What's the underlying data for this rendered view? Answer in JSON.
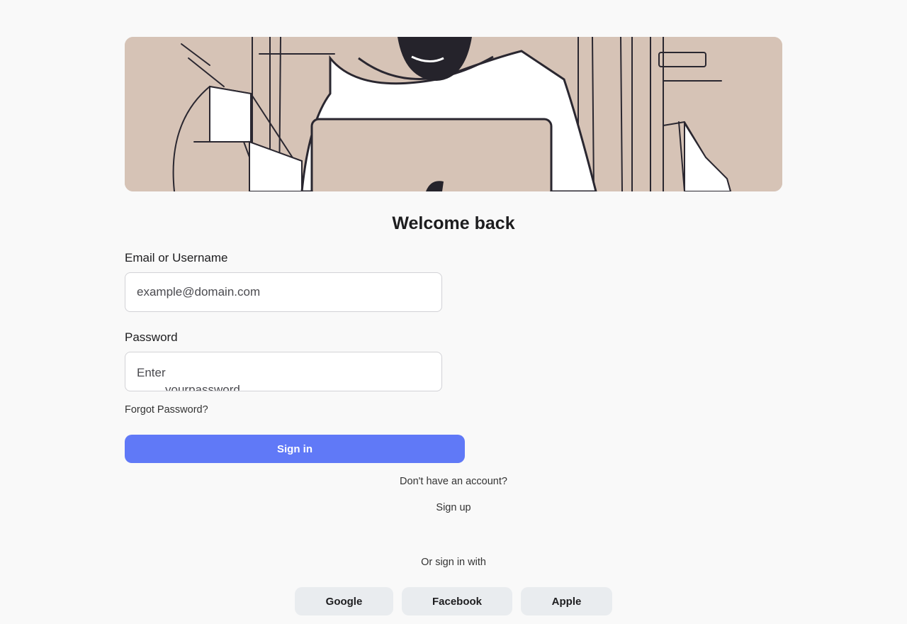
{
  "page": {
    "title": "Welcome back"
  },
  "form": {
    "email_label": "Email or Username",
    "email_placeholder": "example@domain.com",
    "email_value": "",
    "password_label": "Password",
    "password_placeholder_line1": "Enter",
    "password_placeholder_line2": "yourpassword",
    "password_value": "",
    "forgot_label": "Forgot Password?",
    "signin_label": "Sign in"
  },
  "signup": {
    "prompt": "Don't have an account?",
    "link_label": "Sign up"
  },
  "social": {
    "heading": "Or sign in with",
    "buttons": [
      {
        "label": "Google"
      },
      {
        "label": "Facebook"
      },
      {
        "label": "Apple"
      }
    ]
  },
  "colors": {
    "accent": "#6079f7",
    "hero_bg": "#d6c3b6",
    "social_bg": "#e9ecef"
  }
}
